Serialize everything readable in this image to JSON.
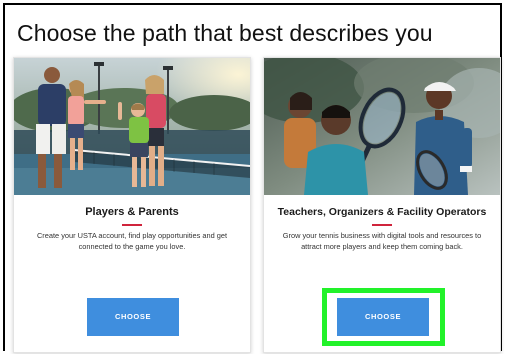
{
  "page": {
    "title": "Choose the path that best describes you"
  },
  "cards": [
    {
      "heading": "Players & Parents",
      "description": "Create your USTA account, find play opportunities and get connected to the game you love.",
      "button_label": "CHOOSE",
      "image_icon": "tennis-family-photo"
    },
    {
      "heading": "Teachers, Organizers & Facility Operators",
      "description": "Grow your tennis business with digital tools and resources to attract more players and keep them coming back.",
      "button_label": "CHOOSE",
      "image_icon": "tennis-coach-photo"
    }
  ],
  "colors": {
    "button": "#3f8ede",
    "divider": "#d0243c",
    "highlight": "#22f22a"
  }
}
